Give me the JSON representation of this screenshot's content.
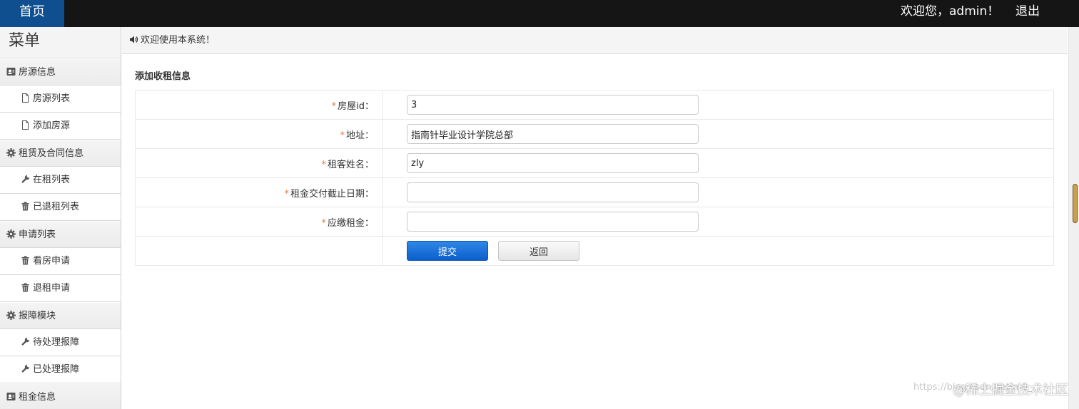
{
  "topbar": {
    "home_label": "首页",
    "welcome_text": "欢迎您，admin！",
    "logout_label": "退出"
  },
  "sidebar": {
    "title": "菜单",
    "sections": [
      {
        "label": "房源信息",
        "icon": "contact-card-icon",
        "items": [
          {
            "label": "房源列表",
            "icon": "document-icon"
          },
          {
            "label": "添加房源",
            "icon": "document-icon"
          }
        ]
      },
      {
        "label": "租赁及合同信息",
        "icon": "gear-icon",
        "items": [
          {
            "label": "在租列表",
            "icon": "wrench-icon"
          },
          {
            "label": "已退租列表",
            "icon": "trash-icon"
          }
        ]
      },
      {
        "label": "申请列表",
        "icon": "gear-icon",
        "items": [
          {
            "label": "看房申请",
            "icon": "trash-icon"
          },
          {
            "label": "退租申请",
            "icon": "trash-icon"
          }
        ]
      },
      {
        "label": "报障模块",
        "icon": "gear-icon",
        "items": [
          {
            "label": "待处理报障",
            "icon": "wrench-icon"
          },
          {
            "label": "已处理报障",
            "icon": "wrench-icon"
          }
        ]
      },
      {
        "label": "租金信息",
        "icon": "contact-card-icon",
        "items": []
      }
    ]
  },
  "welcome_bar": {
    "icon": "speaker-icon",
    "text": "欢迎使用本系统！"
  },
  "form": {
    "title": "添加收租信息",
    "required_mark": "*",
    "fields": [
      {
        "label": "房屋id：",
        "value": "3"
      },
      {
        "label": "地址：",
        "value": "指南针毕业设计学院总部"
      },
      {
        "label": "租客姓名：",
        "value": "zly"
      },
      {
        "label": "租金交付截止日期：",
        "value": ""
      },
      {
        "label": "应缴租金：",
        "value": ""
      }
    ],
    "submit_label": "提交",
    "back_label": "返回"
  },
  "watermark": {
    "url": "https://blog.csdn.net/m0_...",
    "brand": "@稀土掘金技术社区"
  },
  "colors": {
    "topbar_bg": "#151515",
    "home_tab_bg": "#0f4f8f",
    "submit_bg": "#0c5fcb",
    "required": "#e27a3f"
  }
}
